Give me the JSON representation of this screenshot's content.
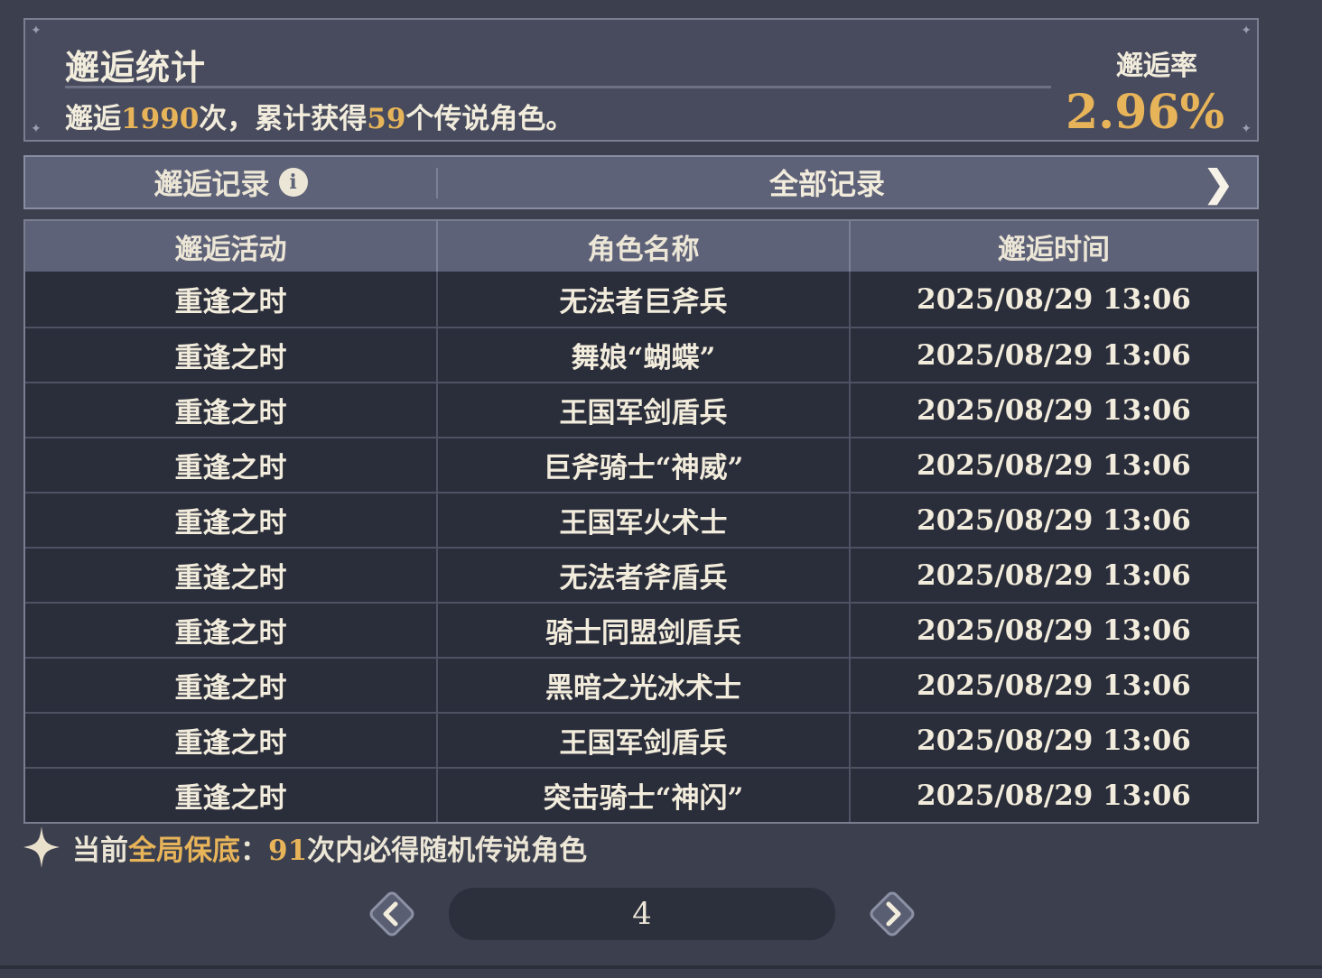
{
  "stats": {
    "title": "邂逅统计",
    "summary_prefix": "邂逅",
    "total_pulls": "1990",
    "summary_middle": "次，累计获得",
    "legend_count": "59",
    "summary_suffix": "个传说角色。",
    "rate_label": "邂逅率",
    "rate_value": "2.96%"
  },
  "records_bar": {
    "label": "邂逅记录",
    "info_icon": "i",
    "filter": "全部记录",
    "arrow": "❯"
  },
  "table": {
    "headers": [
      "邂逅活动",
      "角色名称",
      "邂逅时间"
    ],
    "rows": [
      {
        "event": "重逢之时",
        "name": "无法者巨斧兵",
        "time": "2025/08/29 13:06"
      },
      {
        "event": "重逢之时",
        "name": "舞娘“蝴蝶”",
        "time": "2025/08/29 13:06"
      },
      {
        "event": "重逢之时",
        "name": "王国军剑盾兵",
        "time": "2025/08/29 13:06"
      },
      {
        "event": "重逢之时",
        "name": "巨斧骑士“神威”",
        "time": "2025/08/29 13:06"
      },
      {
        "event": "重逢之时",
        "name": "王国军火术士",
        "time": "2025/08/29 13:06"
      },
      {
        "event": "重逢之时",
        "name": "无法者斧盾兵",
        "time": "2025/08/29 13:06"
      },
      {
        "event": "重逢之时",
        "name": "骑士同盟剑盾兵",
        "time": "2025/08/29 13:06"
      },
      {
        "event": "重逢之时",
        "name": "黑暗之光冰术士",
        "time": "2025/08/29 13:06"
      },
      {
        "event": "重逢之时",
        "name": "王国军剑盾兵",
        "time": "2025/08/29 13:06"
      },
      {
        "event": "重逢之时",
        "name": "突击骑士“神闪”",
        "time": "2025/08/29 13:06"
      }
    ]
  },
  "pity": {
    "prefix": "当前",
    "highlight": "全局保底",
    "colon": "：",
    "count": "91",
    "suffix": "次内必得随机传说角色"
  },
  "pager": {
    "current_page": "4"
  },
  "colors": {
    "accent_gold": "#e8b45a",
    "background": "#3c3f4e",
    "header_bar": "#5e6278",
    "table_body": "#2a2d3a"
  }
}
